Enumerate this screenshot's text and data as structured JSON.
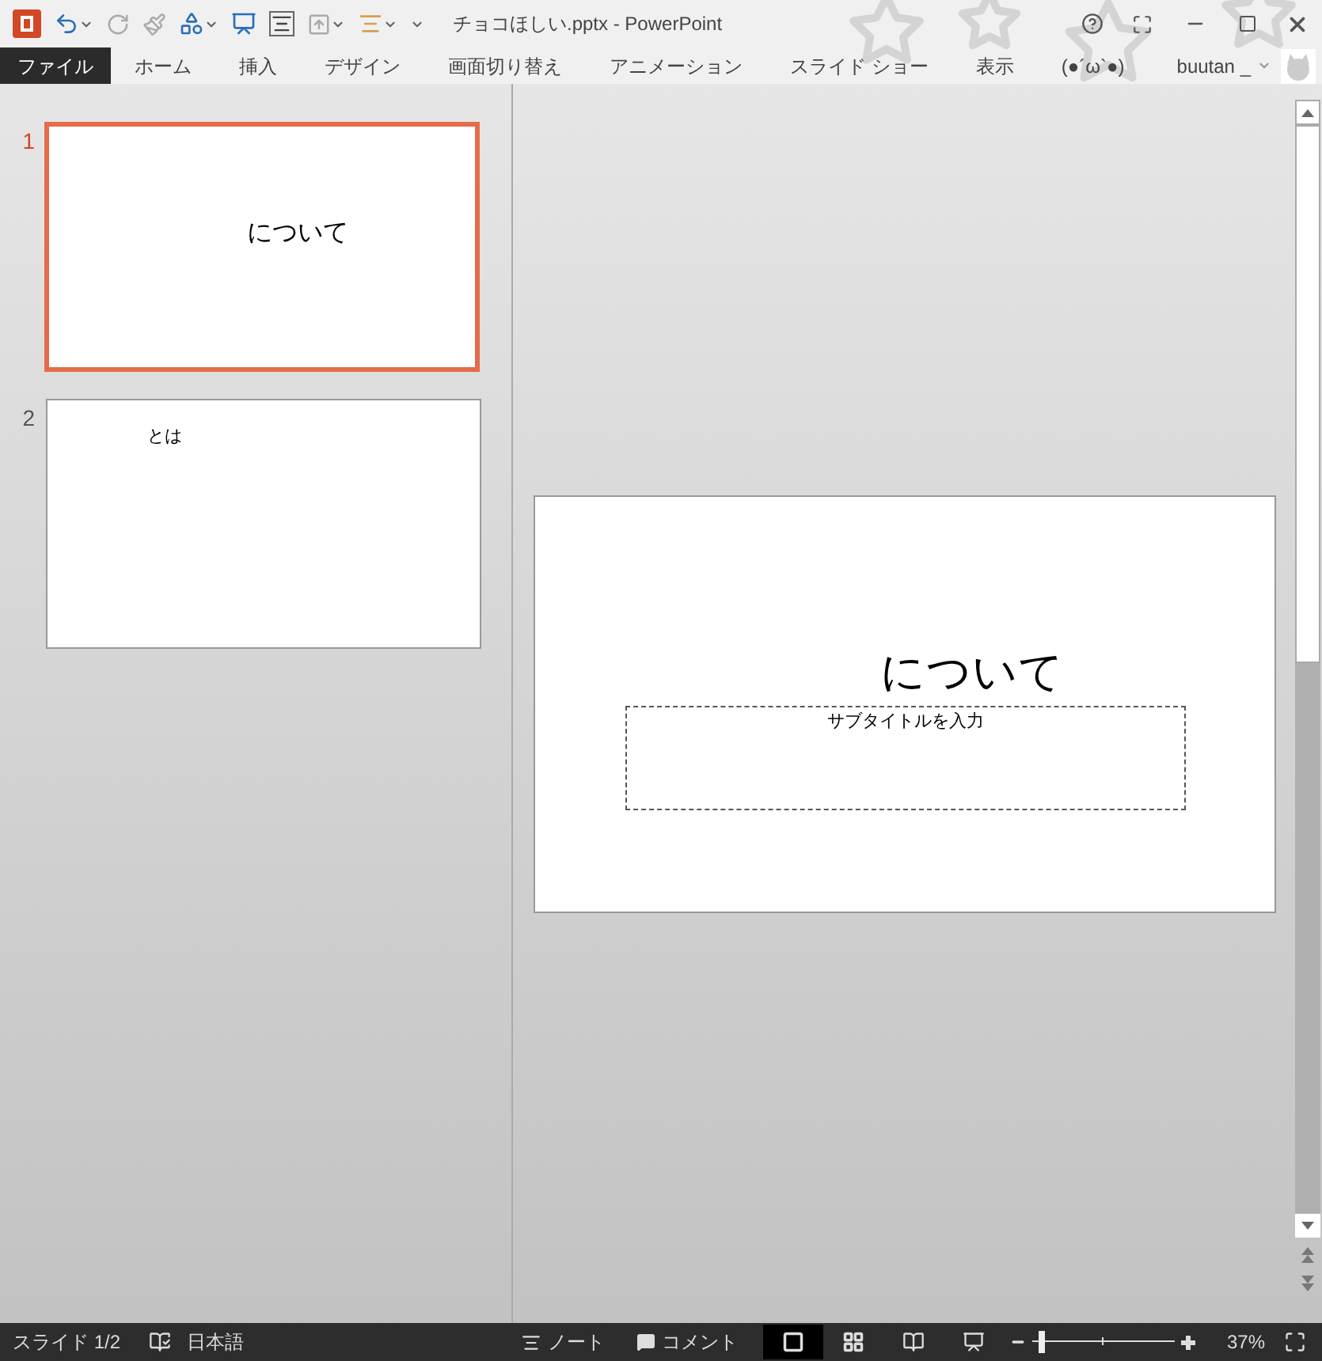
{
  "window": {
    "title": "チョコほしい.pptx - PowerPoint"
  },
  "ribbon_tabs": [
    {
      "label": "ファイル",
      "kind": "backstage"
    },
    {
      "label": "ホーム",
      "kind": "tab"
    },
    {
      "label": "挿入",
      "kind": "tab"
    },
    {
      "label": "デザイン",
      "kind": "tab"
    },
    {
      "label": "画面切り替え",
      "kind": "tab"
    },
    {
      "label": "アニメーション",
      "kind": "tab"
    },
    {
      "label": "スライド ショー",
      "kind": "tab"
    },
    {
      "label": "表示",
      "kind": "tab"
    },
    {
      "label": "(●´ω`●)",
      "kind": "tab"
    }
  ],
  "user": {
    "name": "buutan _"
  },
  "thumbnails": [
    {
      "number": "1",
      "text": "について",
      "kind": "title",
      "selected": true
    },
    {
      "number": "2",
      "text": "とは",
      "kind": "content",
      "selected": false
    }
  ],
  "slide": {
    "title": "について",
    "subtitle_placeholder": "サブタイトルを入力"
  },
  "status_bar": {
    "slide": "スライド 1/2",
    "language": "日本語",
    "notes": "ノート",
    "comments": "コメント",
    "views": [
      {
        "kind": "normal",
        "selected": true
      },
      {
        "kind": "sorter",
        "selected": false
      },
      {
        "kind": "reading",
        "selected": false
      },
      {
        "kind": "slideshow",
        "selected": false
      }
    ],
    "zoom": {
      "level": 0.05,
      "reading": "37%"
    }
  }
}
